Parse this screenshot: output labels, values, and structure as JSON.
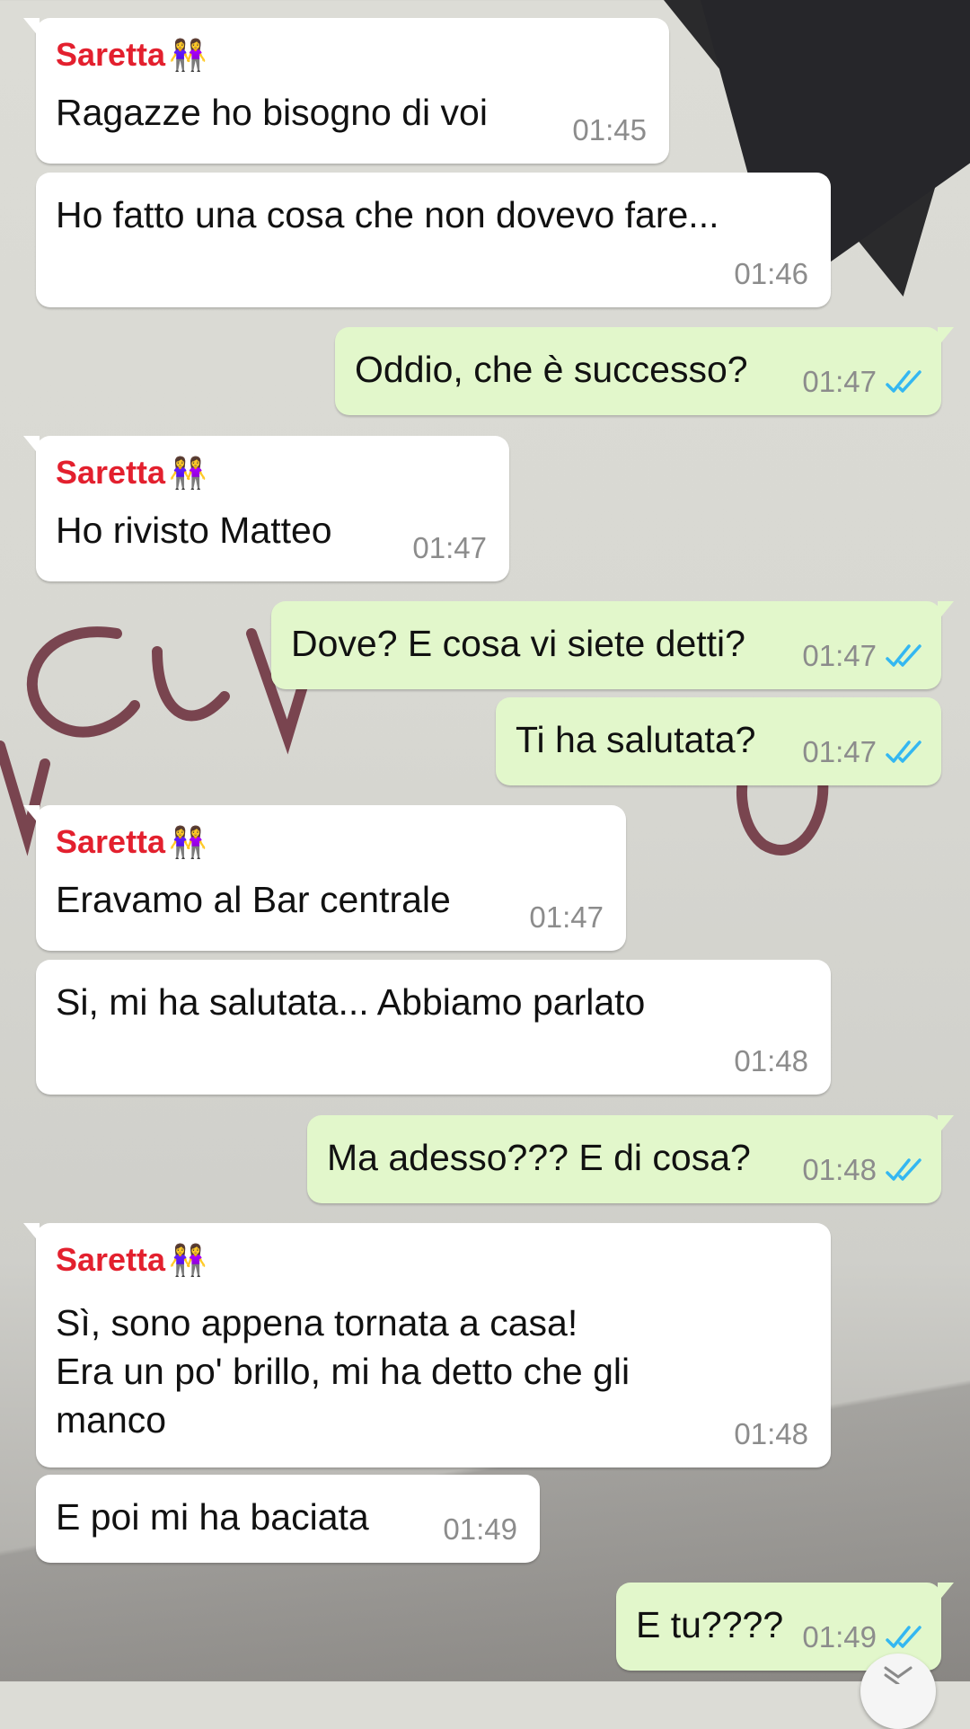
{
  "chat": {
    "sender_name": "Saretta",
    "sender_emoji": "👭",
    "messages": [
      {
        "dir": "in",
        "sender": true,
        "text": "Ragazze ho bisogno di voi",
        "time": "01:45"
      },
      {
        "dir": "in",
        "sender": false,
        "text": "Ho fatto una cosa che non dovevo fare...",
        "time": "01:46"
      },
      {
        "dir": "out",
        "text": "Oddio, che è successo?",
        "time": "01:47",
        "status": "read"
      },
      {
        "dir": "in",
        "sender": true,
        "text": "Ho rivisto Matteo",
        "time": "01:47"
      },
      {
        "dir": "out",
        "text": "Dove? E cosa vi siete detti?",
        "time": "01:47",
        "status": "read"
      },
      {
        "dir": "out",
        "text": "Ti ha salutata?",
        "time": "01:47",
        "status": "read"
      },
      {
        "dir": "in",
        "sender": true,
        "text": "Eravamo al Bar centrale",
        "time": "01:47"
      },
      {
        "dir": "in",
        "sender": false,
        "text": "Si, mi ha salutata... Abbiamo parlato",
        "time": "01:48"
      },
      {
        "dir": "out",
        "text": "Ma adesso??? E di cosa?",
        "time": "01:48",
        "status": "read"
      },
      {
        "dir": "in",
        "sender": true,
        "lines": [
          "Sì, sono appena tornata a casa!",
          "Era un po' brillo, mi ha detto che gli",
          "manco"
        ],
        "time": "01:48"
      },
      {
        "dir": "in",
        "sender": false,
        "text": "E poi mi ha baciata",
        "time": "01:49"
      },
      {
        "dir": "out",
        "text": "E tu????",
        "time": "01:49",
        "status": "read"
      }
    ]
  },
  "colors": {
    "incoming_bubble": "#ffffff",
    "outgoing_bubble": "#e2f7cb",
    "sender_name": "#e3202e",
    "timestamp": "#8c8c8c",
    "read_ticks": "#34b7f1"
  },
  "icons": {
    "read_receipt": "double-check-icon",
    "scroll_down": "chevron-down-icon"
  }
}
